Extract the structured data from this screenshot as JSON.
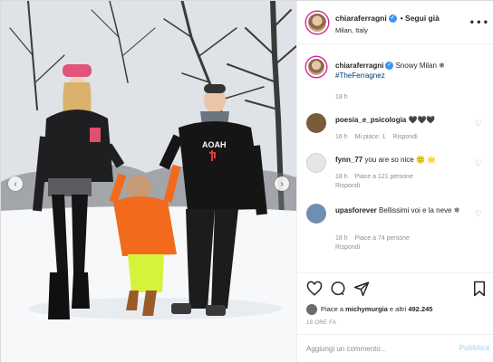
{
  "post": {
    "username": "chiaraferragni",
    "follow_label": "• Segui già",
    "location": "Milan, Italy",
    "more_icon": "more-horizontal-icon"
  },
  "caption": {
    "username": "chiaraferragni",
    "text": "Snowy Milan ❄",
    "hashtag": "#TheFerragnez",
    "time": "18 h"
  },
  "comments": [
    {
      "username": "poesia_e_psicologia",
      "text": "🖤🖤🖤",
      "time": "16 h",
      "likes": "Mi piace: 1",
      "reply": "Rispondi",
      "avatar_color": "#7a5c3a"
    },
    {
      "username": "fynn_77",
      "text": "you are so nice 🙂 🌟",
      "time": "18 h",
      "likes": "Piace a 121 persone",
      "reply": "Rispondi",
      "avatar_color": "#e6e6e6"
    },
    {
      "username": "upasforever",
      "text": "Bellissimi voi e la neve ❄",
      "time": "18 h",
      "likes": "Piace a 74 persone",
      "reply": "Rispondi",
      "avatar_color": "#6f8fb0"
    }
  ],
  "actions": {
    "likes_prefix": "Piace a",
    "likes_user": "michymurgia",
    "likes_middle": "e altri",
    "likes_count": "492.245",
    "time_ago": "18 ORE FA"
  },
  "add_comment": {
    "placeholder": "Aggiungi un commento...",
    "publish_label": "Pubblica"
  },
  "colors": {
    "accent": "#3897f0",
    "publish_disabled": "#b2dffc"
  }
}
